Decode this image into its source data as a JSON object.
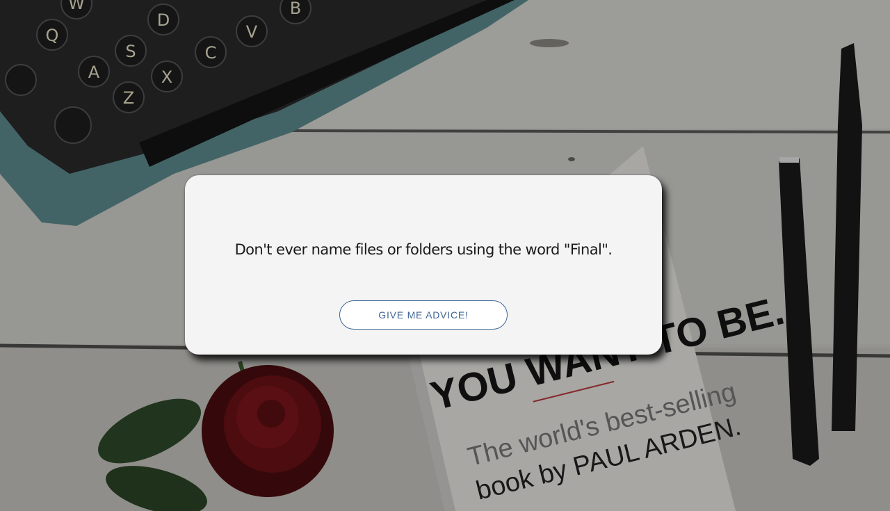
{
  "background": {
    "description_icon": "desk-photo",
    "book_cover": {
      "line1": "YOU WANT TO BE.",
      "line2": "The world's best-selling",
      "line3": "book by PAUL ARDEN."
    },
    "typewriter_keys": [
      "W",
      "B",
      "D",
      "Q",
      "S",
      "V",
      "C",
      "A",
      "Z",
      "X"
    ]
  },
  "advice": {
    "text": "Don't ever name files or folders using the word \"Final\".",
    "button_label": "GIVE ME ADVICE!"
  },
  "colors": {
    "card_bg": "#f4f4f4",
    "button_border": "#3d6596",
    "button_text": "#3d6596"
  }
}
